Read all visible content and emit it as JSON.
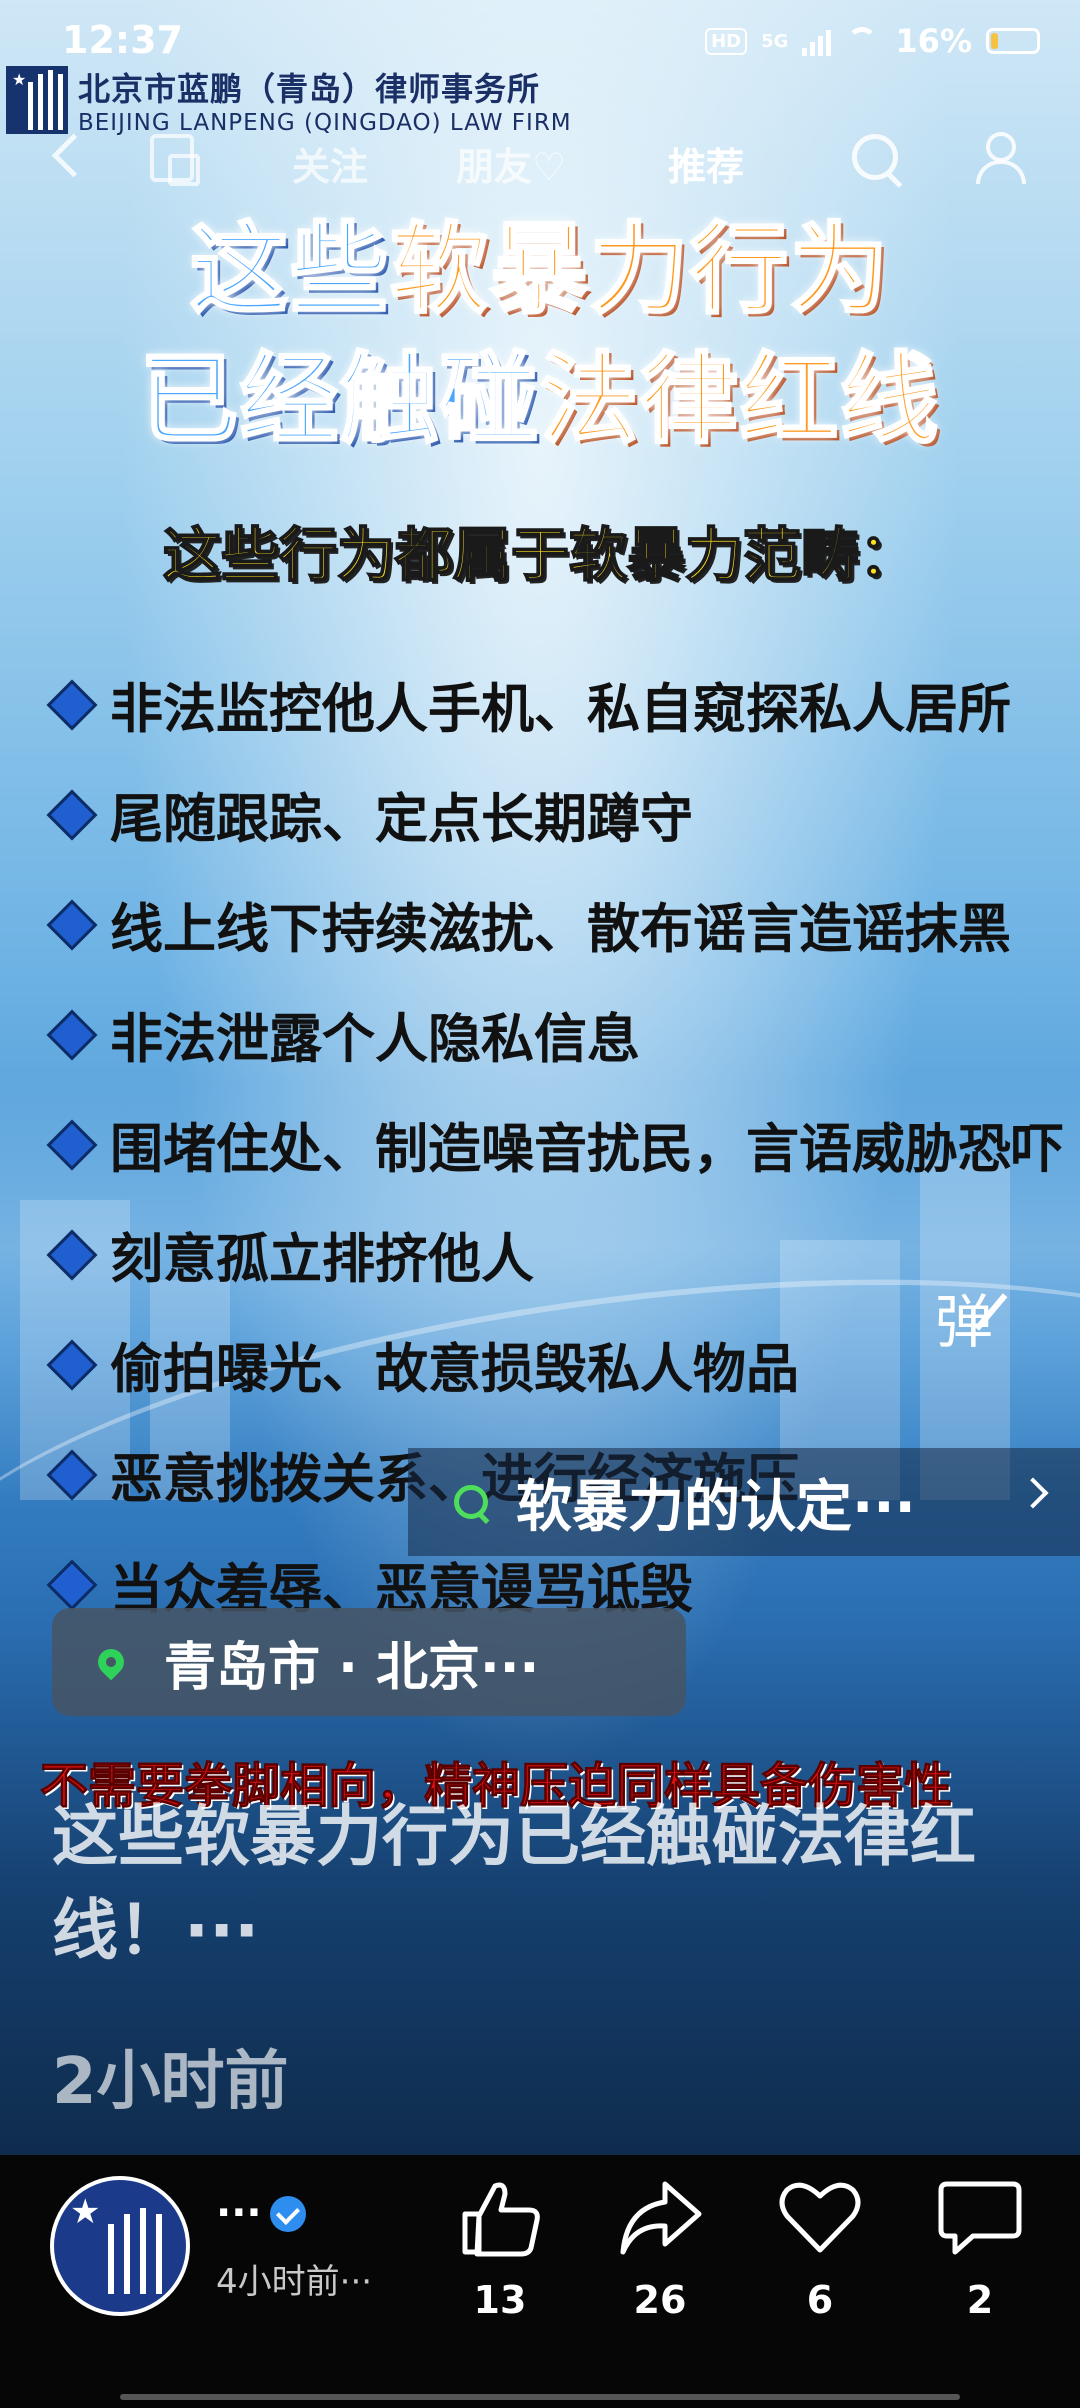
{
  "status_bar": {
    "time": "12:37",
    "hd": "HD",
    "network": "5G",
    "battery": "16%",
    "battery_level": 0.16
  },
  "firm": {
    "name_cn": "北京市蓝鹏（青岛）律师事务所",
    "name_en": "BEIJING LANPENG (QINGDAO) LAW FIRM"
  },
  "nav": {
    "tabs": [
      {
        "label": "关注",
        "active": false
      },
      {
        "label": "朋友♡",
        "active": false
      },
      {
        "label": "推荐",
        "active": true
      }
    ]
  },
  "content": {
    "headline_line1_a": "这些",
    "headline_line1_b": "软暴力行为",
    "headline_line2_a": "已经触碰",
    "headline_line2_b": "法律红线",
    "subhead": "这些行为都属于软暴力范畴：",
    "bullets": [
      "非法监控他人手机、私自窥探私人居所",
      "尾随跟踪、定点长期蹲守",
      "线上线下持续滋扰、散布谣言造谣抹黑",
      "非法泄露个人隐私信息",
      "围堵住处、制造噪音扰民，言语威胁恐吓",
      "刻意孤立排挤他人",
      "偷拍曝光、故意损毁私人物品",
      "恶意挑拨关系、进行经济施压",
      "当众羞辱、恶意谩骂诋毁"
    ],
    "warning": "不需要拳脚相向，精神压迫同样具备伤害性"
  },
  "overlay": {
    "danmaku": "弹",
    "topic": "软暴力的认定···",
    "location": "青岛市 · 北京···",
    "caption": "这些软暴力行为已经触碰法律红线！···",
    "posted": "2小时前"
  },
  "author": {
    "name": "···",
    "time": "4小时前···"
  },
  "actions": {
    "like": "13",
    "share": "26",
    "favorite": "6",
    "comment": "2"
  },
  "colors": {
    "headline_blue": "#4aa6ff",
    "headline_orange": "#ff9a1f",
    "subhead_yellow": "#ffe21c",
    "warning_red": "#e01010",
    "location_pin": "#2ed15a"
  }
}
